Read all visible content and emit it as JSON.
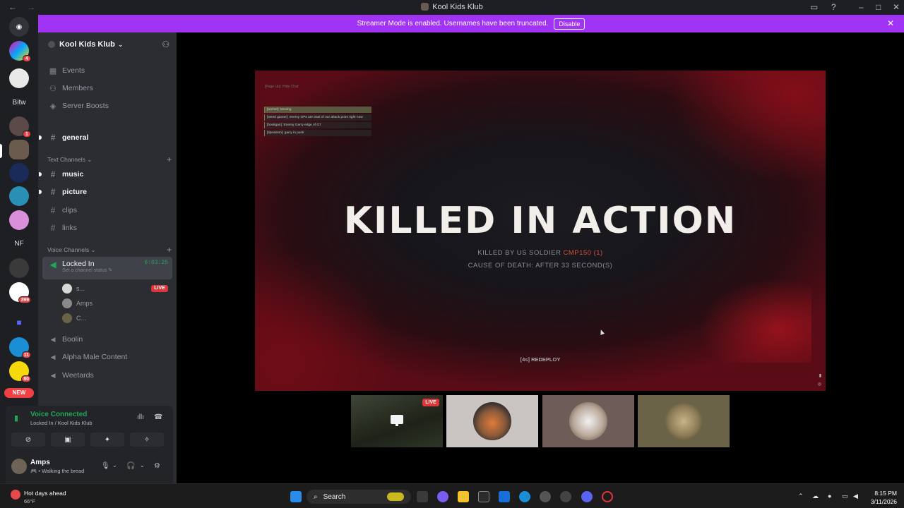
{
  "window": {
    "title": "Kool Kids Klub"
  },
  "banner": {
    "text": "Streamer Mode is enabled. Usernames have been truncated.",
    "disable_label": "Disable"
  },
  "rail": {
    "bitwarden_label": "Bitw",
    "nf_label": "NF",
    "badges": {
      "b1": "4",
      "b2": "1",
      "b3": "399",
      "b4": "11",
      "b5": "80"
    },
    "new_label": "NEW"
  },
  "server": {
    "name": "Kool Kids Klub"
  },
  "nav": {
    "events": "Events",
    "members": "Members",
    "boosts": "Server Boosts"
  },
  "channels": {
    "general": "general",
    "text_category": "Text Channels",
    "text": [
      "music",
      "picture",
      "clips",
      "links"
    ],
    "voice_category": "Voice Channels",
    "locked_in": "Locked In",
    "locked_in_timer": "6:03:25",
    "locked_in_status": "Set a channel status",
    "voice_users": [
      "s...",
      "Amps",
      "C..."
    ],
    "live_label": "LIVE",
    "voice_others": [
      "Boolin",
      "Alpha Male Content",
      "Weetards"
    ]
  },
  "voice_panel": {
    "title": "Voice Connected",
    "subtitle": "Locked In / Kool Kids Klub"
  },
  "user": {
    "name": "Amps",
    "status": "🎮 • Walking the bread"
  },
  "stream": {
    "page_hint": "[Page Up]: Hide Chat",
    "chat": [
      "[archer]: Moving",
      "[weed gamer]: enemy OPs are east of our attack point right now",
      "[hooligan]: Enemy Garry edge of G7",
      "[tipositron]: garry in punk"
    ],
    "headline": "KILLED IN ACTION",
    "killed_by_prefix": "KILLED BY US SOLDIER ",
    "weapon": "CMP150 (1)",
    "cause": "CAUSE OF DEATH:   AFTER 33 SECOND(S)",
    "redeploy": "[4s] REDEPLOY"
  },
  "tiles": {
    "live_label": "LIVE"
  },
  "taskbar": {
    "weather_title": "Hot days ahead",
    "weather_temp": "66°F",
    "search_label": "Search",
    "time": "8:15 PM",
    "date": "3/11/2026"
  },
  "colors": {
    "banner": "#a133f5",
    "voice_green": "#23a55a",
    "live_red": "#da373c",
    "weapon": "#d0533e"
  }
}
